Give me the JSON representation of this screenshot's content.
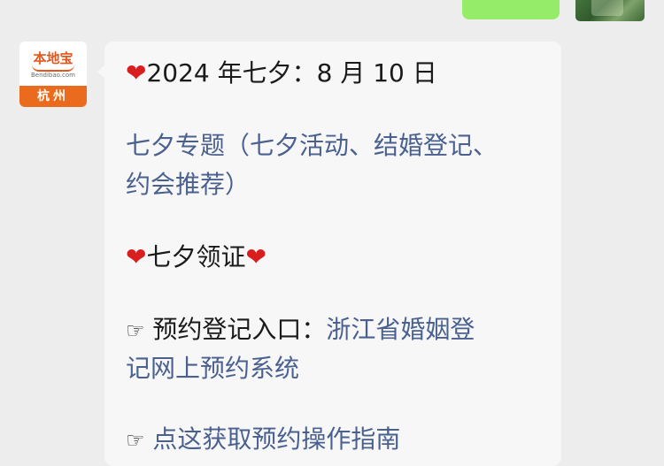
{
  "sender": {
    "logo_brand": "本地宝",
    "logo_url": "Bendibao.com",
    "logo_city": "杭州"
  },
  "message": {
    "date_line": {
      "heart": "❤",
      "text": "2024 年七夕：8 月 10 日"
    },
    "topic_link": {
      "line1": "七夕专题（七夕活动、结婚登记、",
      "line2": "约会推荐）"
    },
    "section_title": {
      "heart_left": "❤",
      "text": "七夕领证",
      "heart_right": "❤"
    },
    "appointment": {
      "pointer": "☞",
      "label": " 预约登记入口：",
      "link_line1": "浙江省婚姻登",
      "link_line2": "记网上预约系统"
    },
    "guide": {
      "pointer": "☞",
      "link": " 点这获取预约操作指南"
    }
  }
}
